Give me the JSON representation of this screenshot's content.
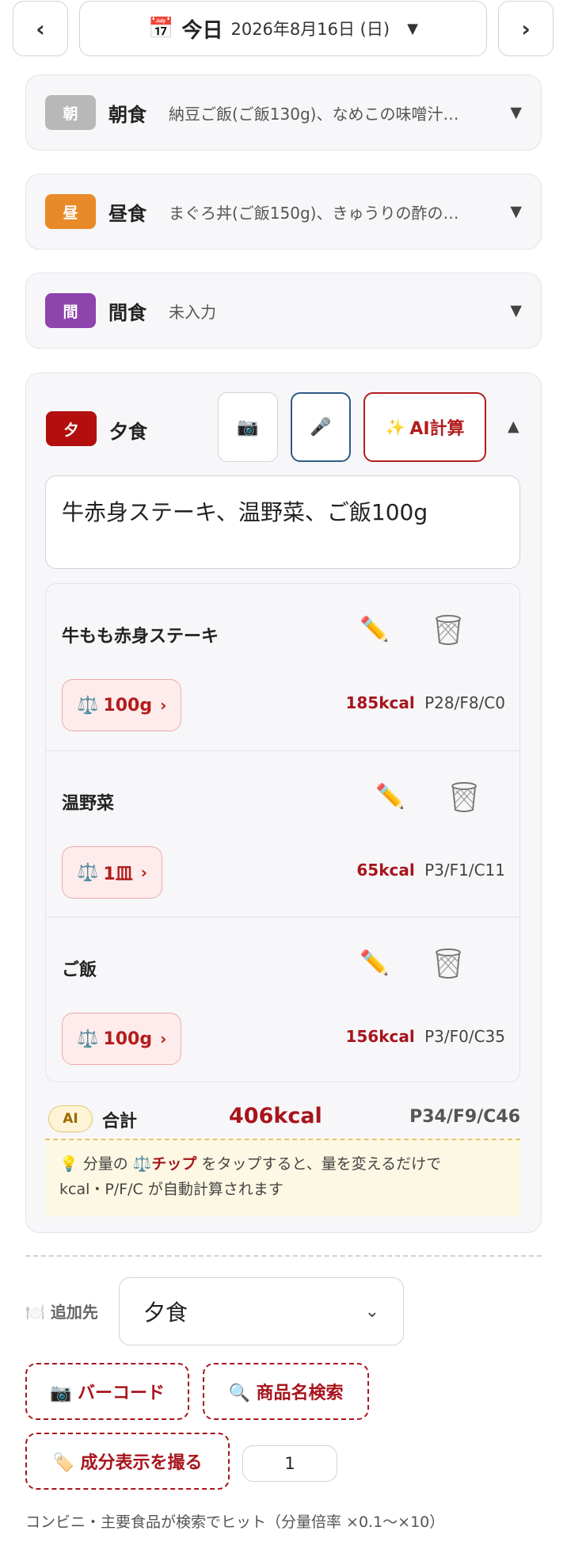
{
  "header": {
    "prev": "‹",
    "next": "›",
    "calendar_icon": "📅",
    "today": "今日",
    "date": "2026年8月16日 (日)",
    "caret": "▼"
  },
  "meals": {
    "breakfast": {
      "badge": "朝",
      "name": "朝食",
      "summary": "納豆ご飯(ご飯130g)、なめこの味噌汁…",
      "caret": "▼",
      "color": "#b8b8b8"
    },
    "lunch": {
      "badge": "昼",
      "name": "昼食",
      "summary": "まぐろ丼(ご飯150g)、きゅうりの酢の…",
      "caret": "▼",
      "color": "#e88a2a"
    },
    "snack": {
      "badge": "間",
      "name": "間食",
      "summary": "未入力",
      "caret": "▼",
      "color": "#8e44ad"
    },
    "dinner": {
      "badge": "夕",
      "name": "夕食",
      "color": "#b30f0f",
      "camera_icon": "📷",
      "mic_icon": "🎤",
      "ai_spark": "✨",
      "ai_label": "AI計算",
      "caret": "▲",
      "input_value": "牛赤身ステーキ、温野菜、ご飯100g",
      "items": [
        {
          "name": "牛もも赤身ステーキ",
          "qty": "100g",
          "kcal": "185kcal",
          "pfc": "P28/F8/C0"
        },
        {
          "name": "温野菜",
          "qty": "1皿",
          "kcal": "65kcal",
          "pfc": "P3/F1/C11"
        },
        {
          "name": "ご飯",
          "qty": "100g",
          "kcal": "156kcal",
          "pfc": "P3/F0/C35"
        }
      ],
      "total": {
        "ai_badge": "AI",
        "label": "合計",
        "kcal": "406kcal",
        "pfc": "P34/F9/C46"
      },
      "tip": {
        "prefix": "💡 分量の ⚖️",
        "chip_word": "チップ",
        "suffix": " をタップすると、量を変えるだけで",
        "line2": "kcal・P/F/C が自動計算されます"
      }
    }
  },
  "add": {
    "dest_label": "🍽️ 追加先",
    "dest_value": "夕食",
    "barcode": "📷 バーコード",
    "search": "🔍 商品名検索",
    "label_photo": "🏷️ 成分表示を撮る",
    "multiplier": "1",
    "footnote": "コンビニ・主要食品が検索でヒット（分量倍率 ×0.1〜×10）"
  }
}
